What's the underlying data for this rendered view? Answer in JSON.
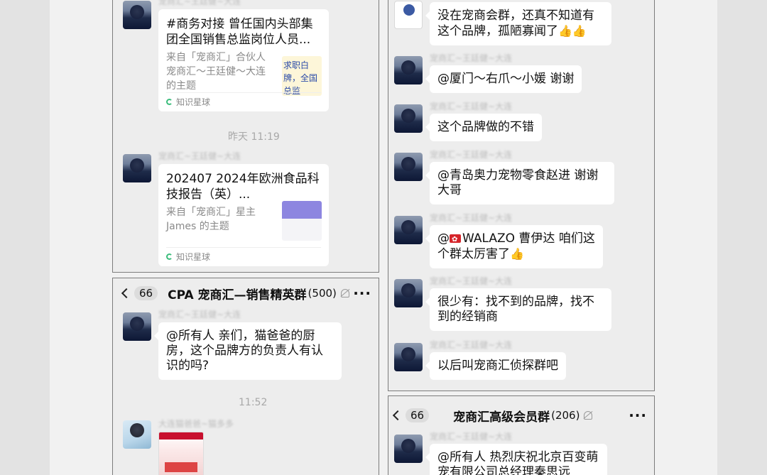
{
  "left_top": {
    "card1": {
      "sender": "宠商汇~王廷健~大连",
      "title": "#商务对接 曾任国内头部集团全国销售总监岗位人员...",
      "desc": "来自「宠商汇」合伙人 宠商汇～王廷健～大连 的主题",
      "thumb_text": "求职白牌，全国总监",
      "footer": "知识星球"
    },
    "time1": "昨天 11:19",
    "card2": {
      "sender": "宠商汇~王廷健~大连",
      "title": "202407  2024年欧洲食品科技报告（英）...",
      "desc": "来自「宠商汇」星主 James 的主题",
      "footer": "知识星球"
    }
  },
  "left_bottom": {
    "header": {
      "back_count": "66",
      "title": "CPA 宠商汇—销售精英群",
      "member_count": "(500)",
      "more": "···"
    },
    "msg1": {
      "sender": "宠商汇~王廷健~大连",
      "text": "@所有人 亲们，猫爸爸的厨房，这个品牌方的负责人有认识的吗?"
    },
    "time2": "11:52",
    "msg2": {
      "sender": "大连猫爸爸~猫多多"
    }
  },
  "right_top": {
    "msg0": {
      "text": "没在宠商会群，还真不知道有这个品牌，孤陋寡闻了",
      "emoji": "👍👍"
    },
    "msg1": {
      "sender": "宠商汇~王廷健~大连",
      "text": "@厦门～右爪～小媛 谢谢"
    },
    "msg2": {
      "sender": "宠商汇~王廷健~大连",
      "text": "这个品牌做的不错"
    },
    "msg3": {
      "sender": "宠商汇~王廷健~大连",
      "text": "@青岛奥力宠物零食赵进 谢谢大哥"
    },
    "msg4": {
      "sender": "宠商汇~王廷健~大连",
      "text": "WALAZO 曹伊达 咱们这个群太厉害了",
      "prefix": "@",
      "emoji": "👍"
    },
    "msg5": {
      "sender": "宠商汇~王廷健~大连",
      "text": "很少有：找不到的品牌，找不到的经销商"
    },
    "msg6": {
      "sender": "宠商汇~王廷健~大连",
      "text": "以后叫宠商汇侦探群吧"
    }
  },
  "right_bottom": {
    "header": {
      "back_count": "66",
      "title": "宠商汇高级会员群",
      "member_count": "(206)",
      "more": "···"
    },
    "msg1": {
      "sender": "宠商汇~王廷健~大连",
      "text": "@所有人 热烈庆祝北京百变萌宠有限公司总经理秦思远"
    }
  }
}
